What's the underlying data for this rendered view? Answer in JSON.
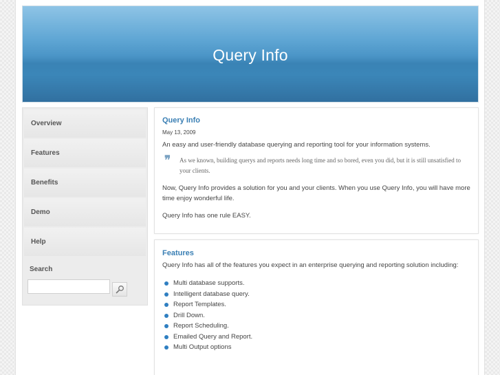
{
  "header": {
    "title": "Query Info"
  },
  "sidebar": {
    "items": [
      {
        "label": "Overview"
      },
      {
        "label": "Features"
      },
      {
        "label": "Benefits"
      },
      {
        "label": "Demo"
      },
      {
        "label": "Help"
      }
    ],
    "search": {
      "title": "Search",
      "placeholder": "",
      "value": "",
      "button_icon": "search-icon"
    }
  },
  "post": {
    "title": "Query Info",
    "date": "May 13, 2009",
    "intro": "An easy and user-friendly database querying and reporting tool for your information systems.",
    "quote": "As we known, building querys and reports needs long time and so bored, even you did, but it is still unsatisfied to your clients.",
    "para2": "Now, Query Info provides a solution for you and your clients. When you use Query Info, you will have more time enjoy wonderful life.",
    "para3": "Query Info has one rule EASY."
  },
  "features": {
    "title": "Features",
    "intro": "Query Info has all of the features you expect in an enterprise querying and reporting solution including:",
    "items": [
      "Multi database supports.",
      "Intelligent database query.",
      "Report Templates.",
      "Drill Down.",
      "Report Scheduling.",
      "Emailed Query and Report.",
      "Multi Output options"
    ]
  },
  "colors": {
    "accent": "#3a7fb4",
    "bullet": "#2f7fc1",
    "banner": "#4b95c7"
  }
}
